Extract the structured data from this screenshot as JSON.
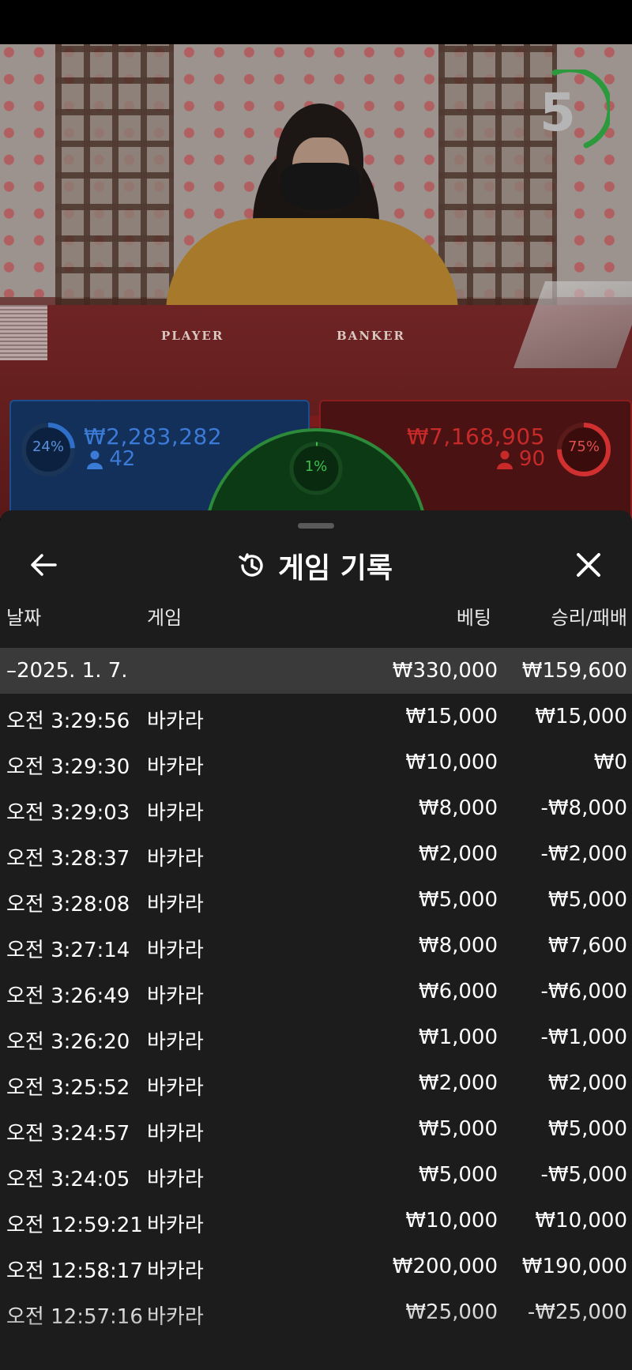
{
  "video": {
    "countdown": "5",
    "table_labels": {
      "player": "PLAYER",
      "banker": "BANKER"
    }
  },
  "bets": {
    "player": {
      "percent": "24%",
      "percent_value": 0.24,
      "amount": "₩2,283,282",
      "count": "42",
      "color": "#2f6fc8"
    },
    "tie": {
      "percent": "1%",
      "percent_value": 0.01,
      "color": "#3fbf4f"
    },
    "banker": {
      "percent": "75%",
      "percent_value": 0.75,
      "amount": "₩7,168,905",
      "count": "90",
      "color": "#d03030"
    }
  },
  "history": {
    "icons": {
      "back": "arrow-left-icon",
      "title": "history-icon",
      "close": "close-icon"
    },
    "title": "게임 기록",
    "columns": {
      "date": "날짜",
      "game": "게임",
      "bet": "베팅",
      "winloss": "승리/패배"
    },
    "summary": {
      "date": "–2025. 1. 7.",
      "bet": "₩330,000",
      "winloss": "₩159,600"
    },
    "rows": [
      {
        "time": "오전 3:29:56",
        "game": "바카라",
        "bet": "₩15,000",
        "winloss": "₩15,000"
      },
      {
        "time": "오전 3:29:30",
        "game": "바카라",
        "bet": "₩10,000",
        "winloss": "₩0"
      },
      {
        "time": "오전 3:29:03",
        "game": "바카라",
        "bet": "₩8,000",
        "winloss": "-₩8,000"
      },
      {
        "time": "오전 3:28:37",
        "game": "바카라",
        "bet": "₩2,000",
        "winloss": "-₩2,000"
      },
      {
        "time": "오전 3:28:08",
        "game": "바카라",
        "bet": "₩5,000",
        "winloss": "₩5,000"
      },
      {
        "time": "오전 3:27:14",
        "game": "바카라",
        "bet": "₩8,000",
        "winloss": "₩7,600"
      },
      {
        "time": "오전 3:26:49",
        "game": "바카라",
        "bet": "₩6,000",
        "winloss": "-₩6,000"
      },
      {
        "time": "오전 3:26:20",
        "game": "바카라",
        "bet": "₩1,000",
        "winloss": "-₩1,000"
      },
      {
        "time": "오전 3:25:52",
        "game": "바카라",
        "bet": "₩2,000",
        "winloss": "₩2,000"
      },
      {
        "time": "오전 3:24:57",
        "game": "바카라",
        "bet": "₩5,000",
        "winloss": "₩5,000"
      },
      {
        "time": "오전 3:24:05",
        "game": "바카라",
        "bet": "₩5,000",
        "winloss": "-₩5,000"
      },
      {
        "time": "오전 12:59:21",
        "game": "바카라",
        "bet": "₩10,000",
        "winloss": "₩10,000"
      },
      {
        "time": "오전 12:58:17",
        "game": "바카라",
        "bet": "₩200,000",
        "winloss": "₩190,000"
      },
      {
        "time": "오전 12:57:16",
        "game": "바카라",
        "bet": "₩25,000",
        "winloss": "-₩25,000"
      }
    ]
  }
}
